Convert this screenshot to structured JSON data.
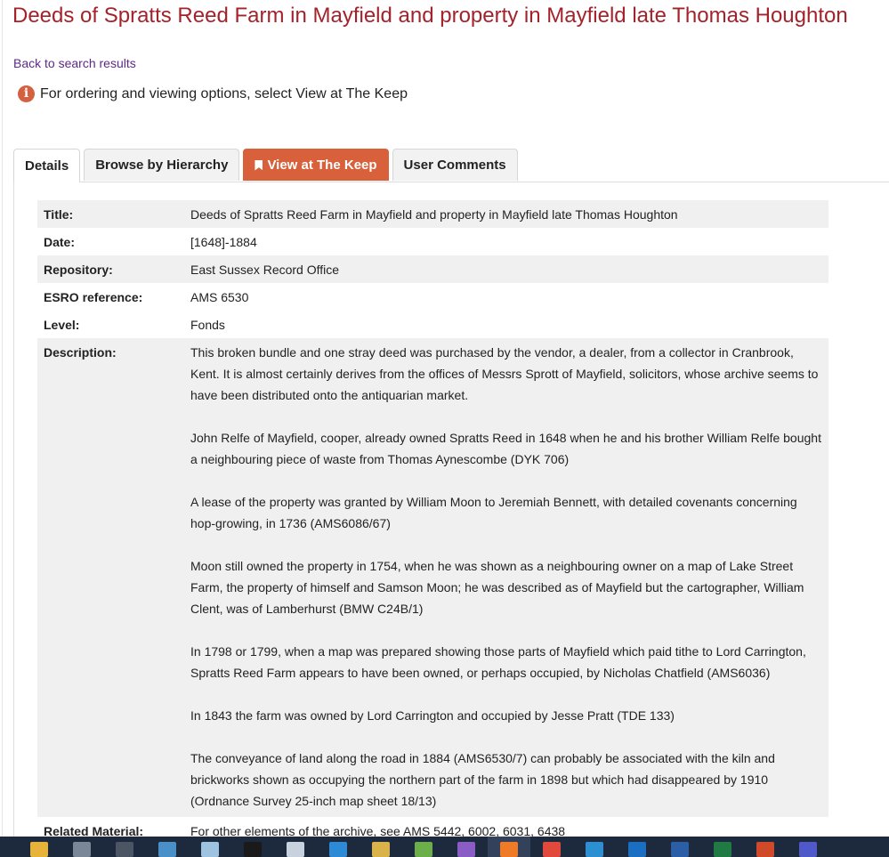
{
  "title": "Deeds of Spratts Reed Farm in Mayfield and property in Mayfield late Thomas Houghton",
  "back_link": "Back to search results",
  "info_text": "For ordering and viewing options, select View at The Keep",
  "tabs": {
    "details": "Details",
    "hierarchy": "Browse by Hierarchy",
    "keep": "View at The Keep",
    "comments": "User Comments"
  },
  "record": {
    "title_label": "Title:",
    "title_value": "Deeds of Spratts Reed Farm in Mayfield and property in Mayfield late Thomas Houghton",
    "date_label": "Date:",
    "date_value": "[1648]-1884",
    "repository_label": "Repository:",
    "repository_value": "East Sussex Record Office",
    "ref_label": "ESRO reference:",
    "ref_value": "AMS 6530",
    "level_label": "Level:",
    "level_value": "Fonds",
    "description_label": "Description:",
    "description": [
      "This broken bundle and one stray deed was purchased by the vendor, a dealer, from a collector in Cranbrook, Kent. It is almost certainly derives from the offices of Messrs Sprott of Mayfield, solicitors, whose archive seems to have been distributed onto the antiquarian market.",
      "John Relfe of Mayfield, cooper, already owned Spratts Reed in 1648 when he and his brother William Relfe bought a neighbouring piece of waste from Thomas Aynescombe (DYK 706)",
      "A lease of the property was granted by William Moon to Jeremiah Bennett, with detailed covenants concerning hop-growing, in 1736 (AMS6086/67)",
      "Moon still owned the property in 1754, when he was shown as a neighbouring owner on a map of Lake Street Farm, the property of himself and Samson Moon; he was described as of Mayfield but the cartographer, William Clent, was of Lamberhurst (BMW C24B/1)",
      "In 1798 or 1799, when a map was prepared showing those parts of Mayfield which paid tithe to Lord Carrington, Spratts Reed Farm appears to have been owned, or perhaps occupied, by Nicholas Chatfield (AMS6036)",
      "In 1843 the farm was owned by Lord Carrington and occupied by Jesse Pratt (TDE 133)",
      "The conveyance of land along the road in 1884 (AMS6530/7) can probably be associated with the kiln and brickworks shown as occupying the northern part of the farm in 1898 but which had disappeared by 1910 (Ordnance Survey 25-inch map sheet 18/13)"
    ],
    "related_label": "Related Material:",
    "related_value": "For other elements of the archive, see AMS 5442, 6002, 6031, 6438"
  },
  "colors": {
    "title": "#a3232b",
    "link": "#5c2a86",
    "accent": "#d8613c",
    "row_shade": "#f0f0f0",
    "taskbar": "#1d2a3e"
  },
  "taskbar_icons": [
    {
      "name": "file-explorer-icon",
      "color": "#e8b33a"
    },
    {
      "name": "calculator-icon",
      "color": "#7a8796"
    },
    {
      "name": "camera-icon",
      "color": "#4b5563"
    },
    {
      "name": "feather-icon",
      "color": "#4a90c8"
    },
    {
      "name": "snipping-tool-icon",
      "color": "#9ec3e0"
    },
    {
      "name": "terminal-icon",
      "color": "#1a1a1a"
    },
    {
      "name": "paint-icon",
      "color": "#c7d2de"
    },
    {
      "name": "vscode-icon",
      "color": "#2d8ad7"
    },
    {
      "name": "archive-icon",
      "color": "#d9b34a"
    },
    {
      "name": "gallery-icon",
      "color": "#6cae4a"
    },
    {
      "name": "visual-studio-icon",
      "color": "#8a5cc6"
    },
    {
      "name": "firefox-icon",
      "color": "#ef7b28",
      "active": true
    },
    {
      "name": "chrome-icon",
      "color": "#e0493b"
    },
    {
      "name": "ve-app-icon",
      "color": "#2b8fd1"
    },
    {
      "name": "outlook-icon",
      "color": "#1b6fc2"
    },
    {
      "name": "word-icon",
      "color": "#2b5ea7"
    },
    {
      "name": "excel-icon",
      "color": "#1f7a43"
    },
    {
      "name": "powerpoint-icon",
      "color": "#d04a2a"
    },
    {
      "name": "teams-icon",
      "color": "#5059c9"
    }
  ]
}
